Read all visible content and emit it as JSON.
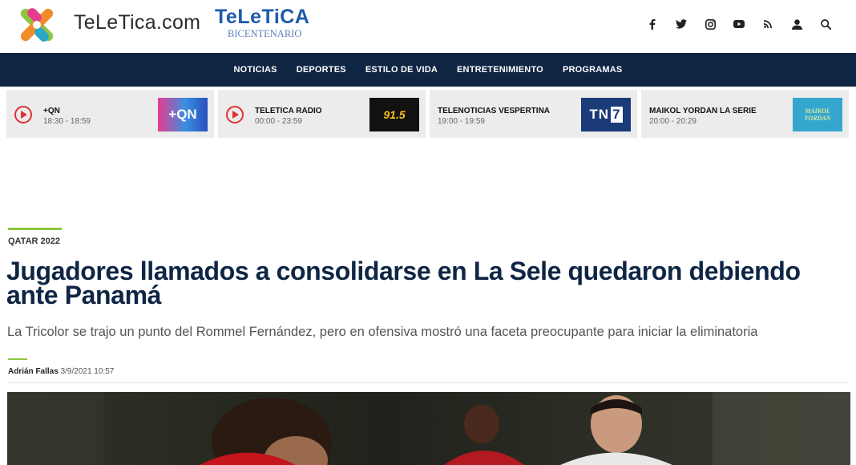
{
  "header": {
    "brand_text": "TeLeTica.com",
    "bicentenario_title": "TeLeTiCA",
    "bicentenario_sub": "BICENTENARIO",
    "social_icons": [
      "facebook-icon",
      "twitter-icon",
      "instagram-icon",
      "youtube-icon",
      "rss-icon",
      "user-icon",
      "search-icon"
    ]
  },
  "nav": {
    "items": [
      "NOTICIAS",
      "DEPORTES",
      "ESTILO DE VIDA",
      "ENTRETENIMIENTO",
      "PROGRAMAS"
    ]
  },
  "schedule": [
    {
      "name": "+QN",
      "time": "18:30 - 18:59",
      "thumb": "+QN"
    },
    {
      "name": "TELETICA RADIO",
      "time": "00:00 - 23:59",
      "thumb": "91.5"
    },
    {
      "name": "TELENOTICIAS VESPERTINA",
      "time": "19:00 - 19:59",
      "thumb_a": "TN",
      "thumb_b": "7"
    },
    {
      "name": "MAIKOL YORDAN LA SERIE",
      "time": "20:00 - 20:29",
      "thumb": "MAIKOL YORDAN"
    }
  ],
  "article": {
    "kicker": "QATAR 2022",
    "headline": "Jugadores llamados a consolidarse en La Sele quedaron debiendo ante Panamá",
    "subhead": "La Tricolor se trajo un punto del Rommel Fernández, pero en ofensiva mostró una faceta preocupante para iniciar la eliminatoria",
    "author": "Adrián Fallas",
    "date": "3/9/2021 10:57"
  },
  "colors": {
    "navy": "#0f2544",
    "accent_green": "#8dc63f",
    "play_red": "#e0312f"
  }
}
